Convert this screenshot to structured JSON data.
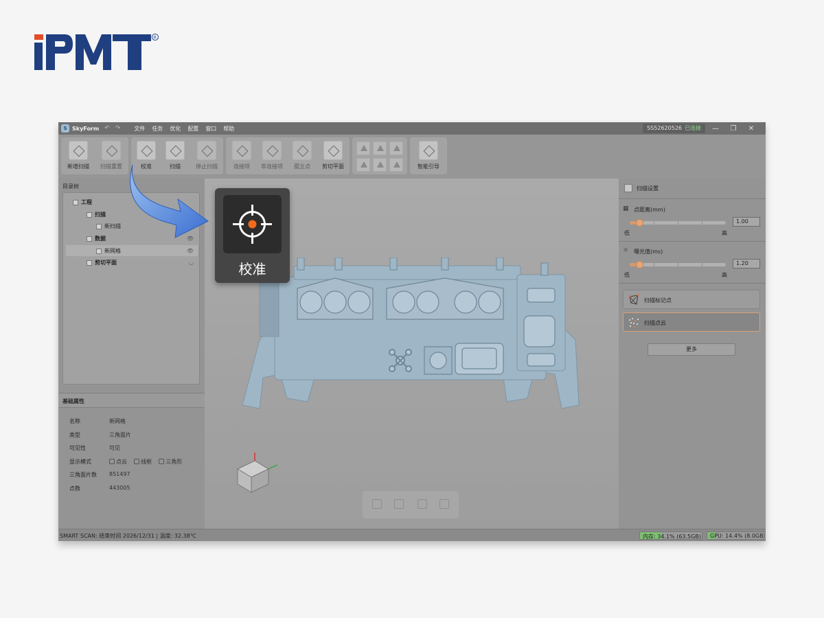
{
  "brand": {
    "logo_text": "PMT",
    "registered": "®",
    "color_primary": "#1f3f80",
    "color_accent": "#e24d2c"
  },
  "titlebar": {
    "app_name": "SkyForm",
    "menus": [
      "文件",
      "任务",
      "优化",
      "配置",
      "窗口",
      "帮助"
    ],
    "device_id": "SS52620526",
    "device_status": "已连接"
  },
  "toolbar": {
    "new_scan": "新增扫描",
    "reset_scan": "扫描重置",
    "calibrate": "校准",
    "scan": "扫描",
    "stop_scan": "停止扫描",
    "connect": "连接项",
    "non_connect": "非连接项",
    "isolated": "孤立点",
    "cut_plane": "剪切平面",
    "smart_guide": "智能引导"
  },
  "tree": {
    "title": "目录树",
    "project": "工程",
    "scan": "扫描",
    "new_scan": "新扫描",
    "data": "数据",
    "new_mesh": "新网格",
    "cut_plane": "剪切平面"
  },
  "props": {
    "title": "基础属性",
    "rows": [
      {
        "k": "名称",
        "v": "新网格"
      },
      {
        "k": "类型",
        "v": "三角面片"
      },
      {
        "k": "可见性",
        "v": "可见"
      },
      {
        "k": "显示模式",
        "v": ""
      },
      {
        "k": "三角面片数",
        "v": "851497"
      },
      {
        "k": "点数",
        "v": "443005"
      }
    ],
    "mode_point": "点云",
    "mode_wire": "线框",
    "mode_tri": "三角形"
  },
  "settings": {
    "title": "扫描设置",
    "density_label": "点距离(mm)",
    "density_value": "1.00",
    "density_level": 0.1,
    "exposure_label": "曝光值(ms)",
    "exposure_value": "1.20",
    "exposure_level": 0.1,
    "low": "低",
    "high": "高",
    "opt_markers": "扫描标记点",
    "opt_cloud": "扫描点云",
    "more": "更多"
  },
  "status": {
    "smart": "SMART SCAN: 结束时间 2026/12/31 | 温度: 32.38℃",
    "mem": "内存: 34.1% (63.5GB)",
    "mem_level": 0.341,
    "gpu": "GPU: 14.4% (8.0GB)",
    "gpu_level": 0.144
  },
  "callout": {
    "label": "校准",
    "accent": "#f26a1b"
  }
}
